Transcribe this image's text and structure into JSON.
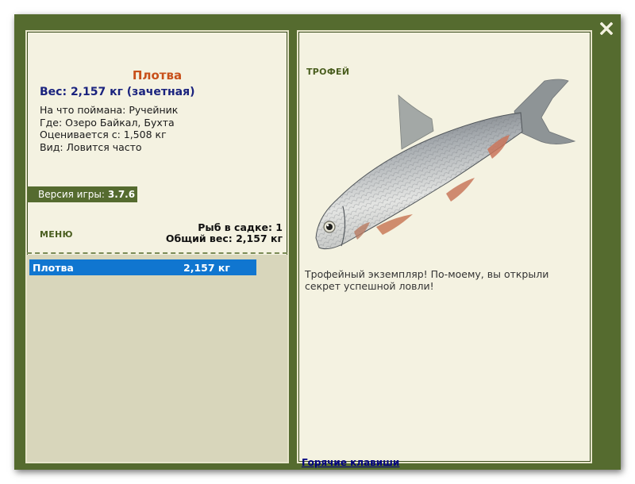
{
  "window": {
    "close_glyph": "X"
  },
  "left_panel": {
    "fish_name": "Плотва",
    "weight_line": "Вес: 2,157 кг (зачетная)",
    "details": [
      "На что поймана: Ручейник",
      "Где: Озеро Байкал, Бухта",
      "Оценивается с: 1,508 кг",
      "Вид: Ловится часто"
    ],
    "version_label": "Версия игры:",
    "version_number": "3.7.6",
    "menu_label": "МЕНЮ",
    "keep_count_line": "Рыб в садке: 1",
    "keep_weight_line": "Общий вес: 2,157 кг",
    "catch_list": [
      {
        "name": "Плотва",
        "weight": "2,157 кг",
        "selected": true
      }
    ]
  },
  "right_panel": {
    "trophy_label": "ТРОФЕЙ",
    "fish_image_icon": "roach-fish-image",
    "trophy_message": "Трофейный экземпляр! По-моему, вы открыли секрет успешной ловли!",
    "hotkeys_link": "Горячие клавиши"
  },
  "colors": {
    "frame_green": "#556b2f",
    "panel_bg": "#f4f2e1",
    "list_bg": "#d8d6bb",
    "selection_blue": "#1076d0",
    "title_orange": "#c8501a",
    "weight_navy": "#1a237e"
  }
}
